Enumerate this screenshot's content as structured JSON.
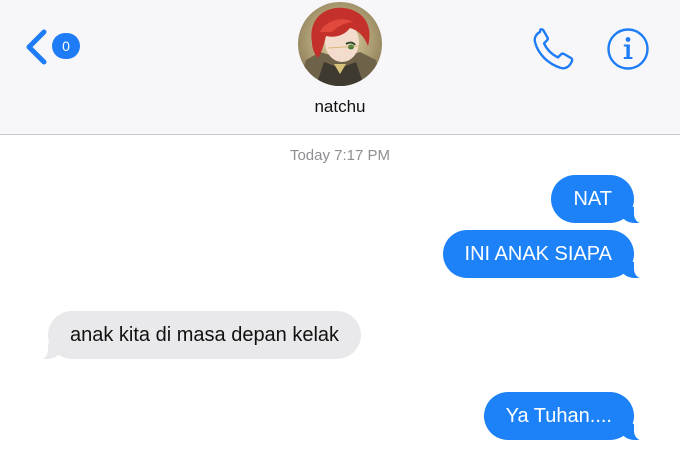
{
  "header": {
    "back_badge_count": "0",
    "contact_name": "natchu",
    "icons": {
      "back": "chevron-left-icon",
      "phone": "phone-icon",
      "info": "info-icon"
    }
  },
  "conversation": {
    "timestamp": "Today 7:17 PM",
    "messages": [
      {
        "direction": "outgoing",
        "text": "NAT"
      },
      {
        "direction": "outgoing",
        "text": "INI ANAK SIAPA"
      },
      {
        "direction": "incoming",
        "text": "anak kita di masa depan kelak"
      },
      {
        "direction": "outgoing",
        "text": "Ya Tuhan...."
      }
    ]
  },
  "colors": {
    "accent": "#1e7cf6",
    "outgoing_bubble": "#1d82f8",
    "incoming_bubble": "#e9e9eb",
    "header_background": "#f7f7f9",
    "timestamp_text": "#8e8e93"
  }
}
